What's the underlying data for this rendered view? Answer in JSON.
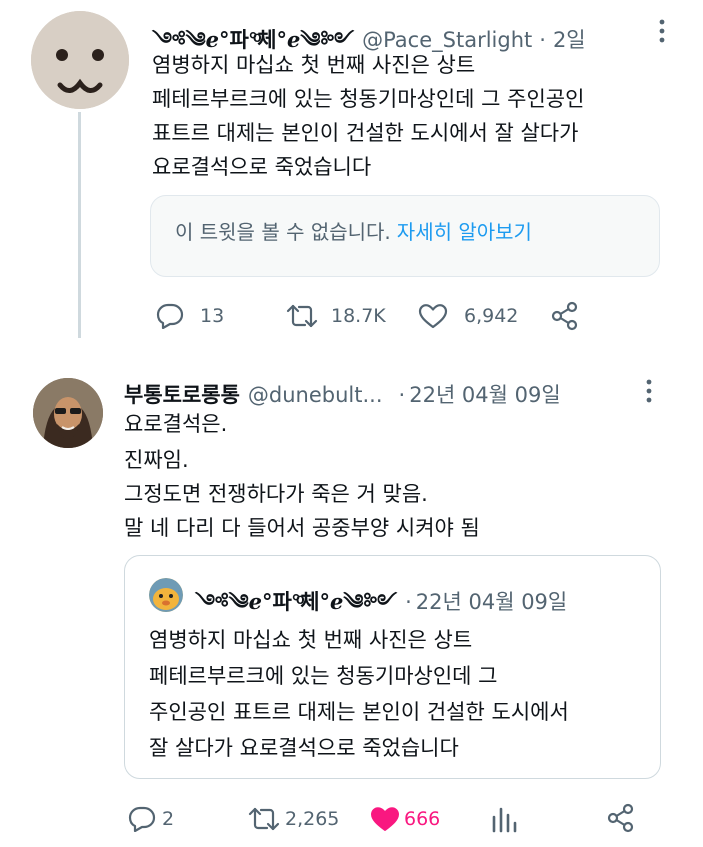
{
  "tweet1": {
    "display_name": "༺༄ℯ°파°ͦ체°ℯ༄༻",
    "handle": "@Pace_Starlight",
    "separator": "·",
    "time": "2일",
    "lines": [
      "염병하지 마십쇼 첫 번째 사진은 상트",
      "페테르부르크에 있는 청동기마상인데 그 주인공인",
      "표트르 대제는 본인이 건설한 도시에서 잘 살다가",
      "요로결석으로 죽었습니다"
    ],
    "unavailable_notice": "이 트윗을 볼 수 없습니다.",
    "learn_more": "자세히 알아보기",
    "replies": "13",
    "retweets": "18.7K",
    "likes": "6,942"
  },
  "tweet2": {
    "display_name": "부통토로롱통",
    "handle": "@dunebult...",
    "separator": "·",
    "time": "22년 04월 09일",
    "lines": [
      "요로결석은.",
      "진짜임.",
      "그정도면 전쟁하다가 죽은 거 맞음.",
      "말 네 다리 다 들어서 공중부양 시켜야 됨"
    ],
    "quote": {
      "display_name": "༺༄ℯ°파°ͦ체°ℯ༄༻",
      "separator": "·",
      "time": "22년 04월 09일",
      "lines": [
        "염병하지 마십쇼 첫 번째 사진은 상트",
        "페테르부르크에 있는 청동기마상인데 그",
        "주인공인 표트르 대제는 본인이 건설한 도시에서",
        "잘 살다가 요로결석으로 죽었습니다"
      ]
    },
    "replies": "2",
    "retweets": "2,265",
    "likes": "666"
  },
  "icons": {
    "reply": "reply-icon",
    "retweet": "retweet-icon",
    "like": "heart-icon",
    "share": "share-icon",
    "analytics": "analytics-icon",
    "more": "more-icon"
  },
  "colors": {
    "text": "#0f1419",
    "secondary": "#536471",
    "link": "#1d9bf0",
    "like_active": "#f91880",
    "thread_line": "#cfd9de"
  }
}
